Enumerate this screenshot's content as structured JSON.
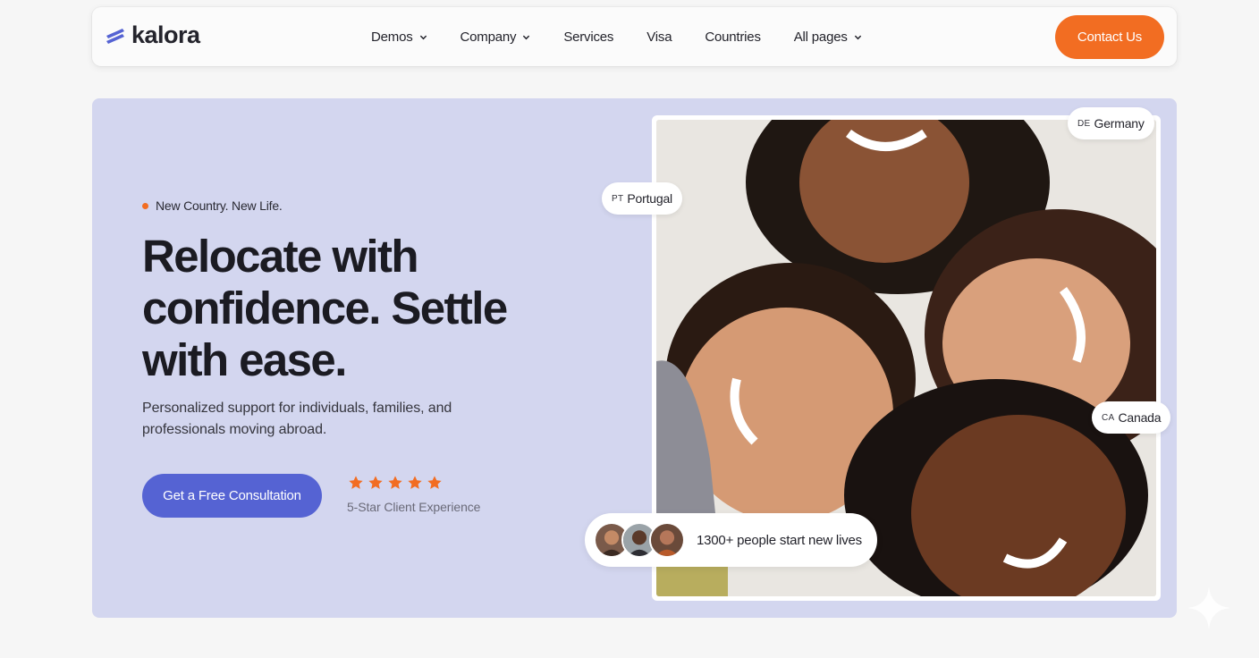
{
  "brand": {
    "name": "kalora",
    "accent": "#f26d22",
    "primary": "#5563d3",
    "hero_bg": "#d3d6ef"
  },
  "nav": {
    "items": [
      {
        "label": "Demos",
        "has_dropdown": true
      },
      {
        "label": "Company",
        "has_dropdown": true
      },
      {
        "label": "Services",
        "has_dropdown": false
      },
      {
        "label": "Visa",
        "has_dropdown": false
      },
      {
        "label": "Countries",
        "has_dropdown": false
      },
      {
        "label": "All pages",
        "has_dropdown": true
      }
    ],
    "contact_label": "Contact Us"
  },
  "hero": {
    "tagline": "New Country. New Life.",
    "headline": "Relocate with confidence. Settle with ease.",
    "subtext": "Personalized support for individuals, families, and professionals moving abroad.",
    "cta_label": "Get a Free Consultation",
    "rating": {
      "stars": 5,
      "label": "5-Star Client Experience"
    },
    "countries": [
      {
        "code": "PT",
        "name": "Portugal"
      },
      {
        "code": "DE",
        "name": "Germany"
      },
      {
        "code": "CA",
        "name": "Canada"
      }
    ],
    "social_proof": "1300+ people start new lives"
  },
  "icons": [
    "logo-mark-icon",
    "chevron-down-icon",
    "star-icon",
    "sparkle-icon"
  ]
}
